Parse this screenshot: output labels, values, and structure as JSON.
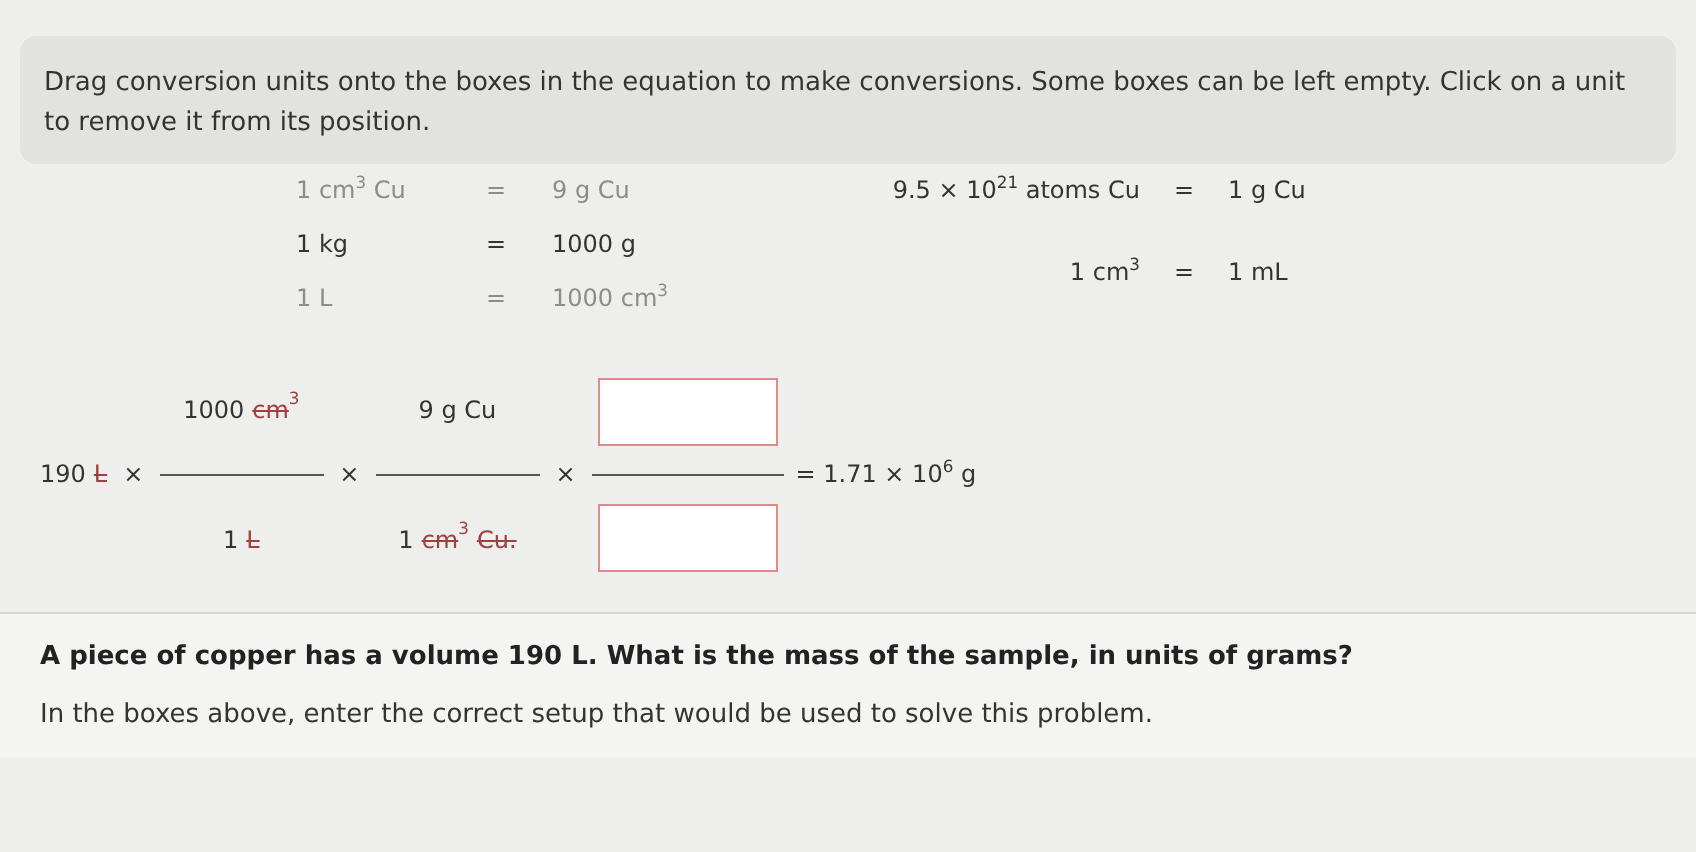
{
  "instructions": "Drag conversion units onto the boxes in the equation to make conversions. Some boxes can be left empty. Click on a unit to remove it from its position.",
  "conversions_left": [
    {
      "left": "1 cm$^{3}$ Cu",
      "equals": "=",
      "right": "9 g Cu",
      "used": true
    },
    {
      "left": "1 kg",
      "equals": "=",
      "right": "1000 g",
      "used": false
    },
    {
      "left": "1 L",
      "equals": "=",
      "right": "1000 cm$^{3}$",
      "used": true
    }
  ],
  "conversions_right": [
    {
      "left": "9.5 × 10$^{21}$ atoms Cu",
      "equals": "=",
      "right": "1 g Cu",
      "used": false
    },
    {
      "left": "1 cm$^{3}$",
      "equals": "=",
      "right": "1 mL",
      "used": false
    }
  ],
  "equation": [
    {
      "kind": "quantity",
      "tokens": [
        {
          "text": "190",
          "cancelled": false
        },
        {
          "text": "L",
          "cancelled": true
        }
      ]
    },
    {
      "kind": "operator",
      "text": "×"
    },
    {
      "kind": "fraction",
      "numerator": [
        {
          "text": "1000",
          "cancelled": false
        },
        {
          "text": "cm$^{3}$",
          "cancelled": true
        }
      ],
      "denominator": [
        {
          "text": "1",
          "cancelled": false
        },
        {
          "text": "L",
          "cancelled": true
        }
      ]
    },
    {
      "kind": "operator",
      "text": "×"
    },
    {
      "kind": "fraction",
      "numerator": [
        {
          "text": "9 g Cu",
          "cancelled": false
        }
      ],
      "denominator": [
        {
          "text": "1",
          "cancelled": false
        },
        {
          "text": "cm$^{3}$",
          "cancelled": true
        },
        {
          "text": "Cu.",
          "cancelled": true
        }
      ]
    },
    {
      "kind": "operator",
      "text": "×"
    },
    {
      "kind": "blank_fraction"
    },
    {
      "kind": "result",
      "text": "= 1.71 × 10$^{6}$ g"
    }
  ],
  "question": "A piece of copper has a volume 190 L. What is the mass of the sample, in units of grams?",
  "prompt": "In the boxes above, enter the correct setup that would be used to solve this problem."
}
